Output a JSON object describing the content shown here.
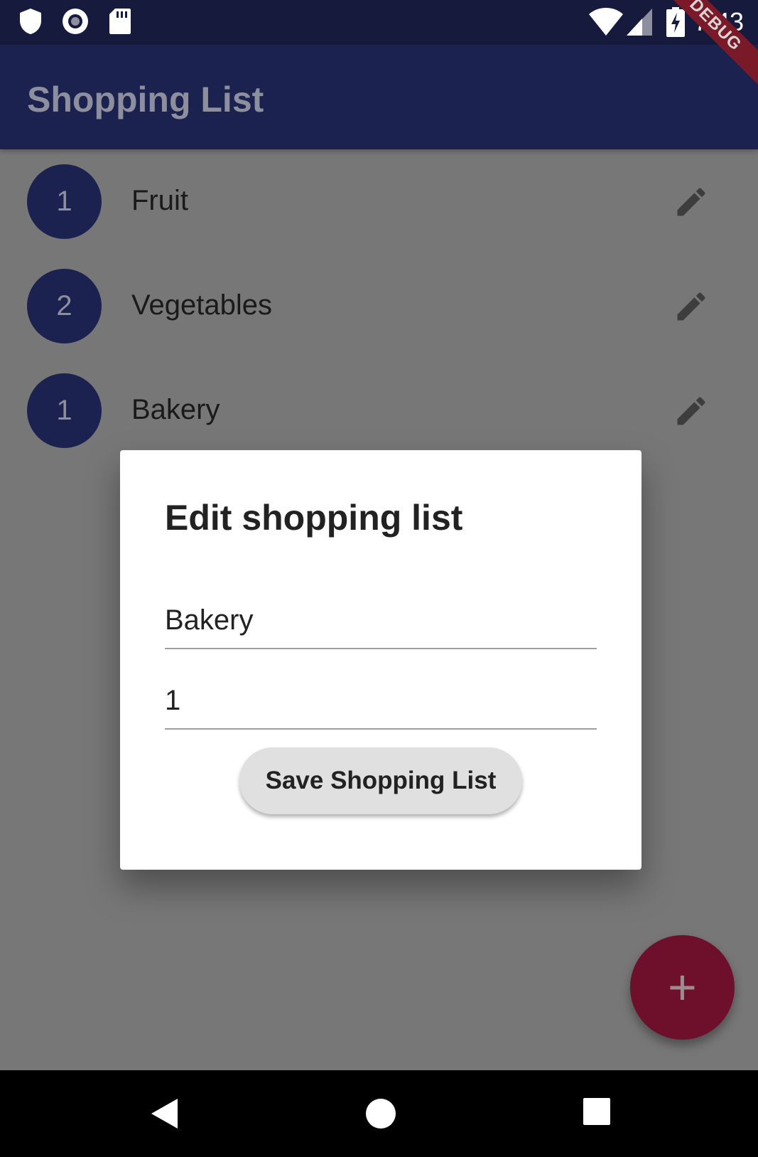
{
  "status_bar": {
    "time": "7:43",
    "debug_label": "DEBUG"
  },
  "app_bar": {
    "title": "Shopping List"
  },
  "lists": [
    {
      "priority": "1",
      "name": "Fruit"
    },
    {
      "priority": "2",
      "name": "Vegetables"
    },
    {
      "priority": "1",
      "name": "Bakery"
    }
  ],
  "dialog": {
    "title": "Edit shopping list",
    "name_value": "Bakery",
    "priority_value": "1",
    "save_label": "Save Shopping List"
  },
  "fab": {
    "label": "+"
  },
  "colors": {
    "primary": "#1c224f",
    "accent": "#6e0f2c",
    "status_bar": "#161b3d"
  }
}
